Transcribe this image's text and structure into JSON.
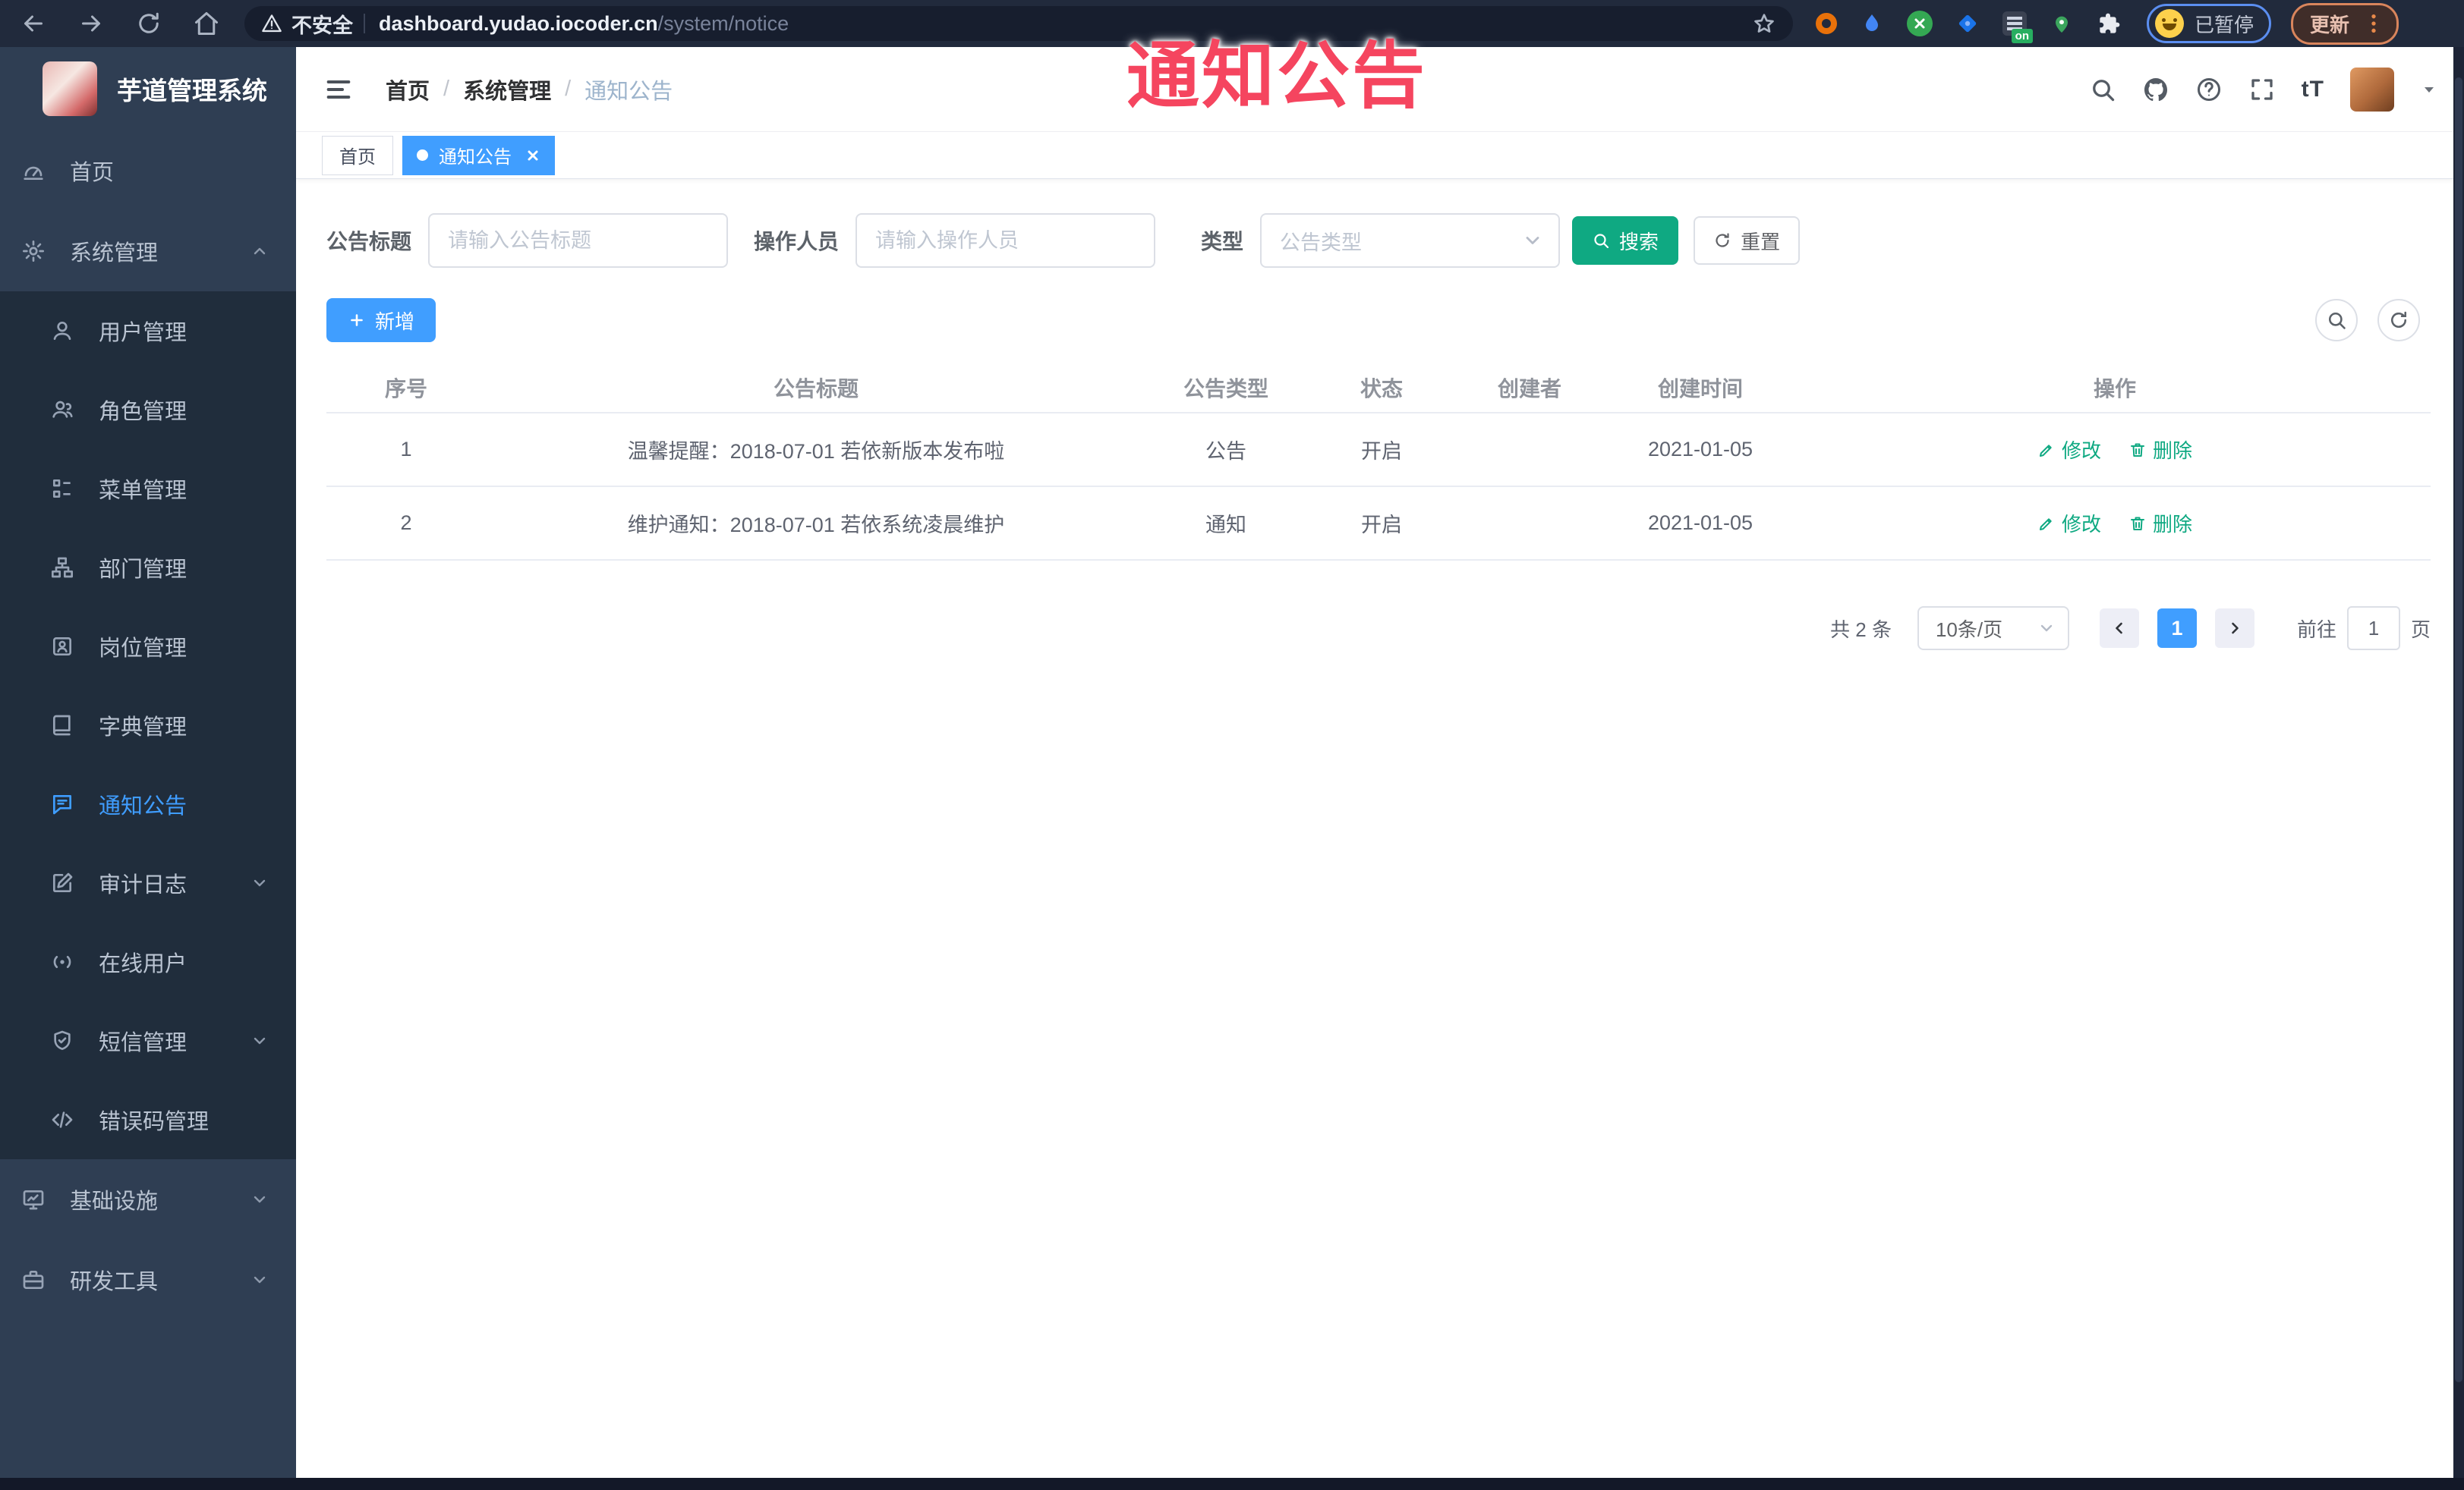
{
  "browser": {
    "security_label": "不安全",
    "url_domain": "dashboard.yudao.iocoder.cn",
    "url_path": "/system/notice",
    "extension_badge": "on",
    "profile_status": "已暂停",
    "update_label": "更新"
  },
  "watermark": "通知公告",
  "sidebar": {
    "title": "芋道管理系统",
    "items": [
      {
        "label": "首页"
      },
      {
        "label": "系统管理"
      },
      {
        "label": "用户管理"
      },
      {
        "label": "角色管理"
      },
      {
        "label": "菜单管理"
      },
      {
        "label": "部门管理"
      },
      {
        "label": "岗位管理"
      },
      {
        "label": "字典管理"
      },
      {
        "label": "通知公告"
      },
      {
        "label": "审计日志"
      },
      {
        "label": "在线用户"
      },
      {
        "label": "短信管理"
      },
      {
        "label": "错误码管理"
      },
      {
        "label": "基础设施"
      },
      {
        "label": "研发工具"
      }
    ]
  },
  "header": {
    "breadcrumb": {
      "home": "首页",
      "separator": "/",
      "section": "系统管理",
      "current": "通知公告"
    },
    "font_size_icon_label": "tT"
  },
  "tabs": {
    "home": "首页",
    "current": "通知公告"
  },
  "filters": {
    "title_label": "公告标题",
    "title_placeholder": "请输入公告标题",
    "operator_label": "操作人员",
    "operator_placeholder": "请输入操作人员",
    "type_label": "类型",
    "type_placeholder": "公告类型",
    "search_label": "搜索",
    "reset_label": "重置"
  },
  "toolbar": {
    "add_label": "新增"
  },
  "table": {
    "headers": {
      "index": "序号",
      "title": "公告标题",
      "type": "公告类型",
      "status": "状态",
      "creator": "创建者",
      "create_time": "创建时间",
      "actions": "操作"
    },
    "rows": [
      {
        "index": "1",
        "title": "温馨提醒：2018-07-01 若依新版本发布啦",
        "type": "公告",
        "status": "开启",
        "creator": "",
        "create_time": "2021-01-05"
      },
      {
        "index": "2",
        "title": "维护通知：2018-07-01 若依系统凌晨维护",
        "type": "通知",
        "status": "开启",
        "creator": "",
        "create_time": "2021-01-05"
      }
    ],
    "edit_label": "修改",
    "delete_label": "删除"
  },
  "pagination": {
    "total_label": "共 2 条",
    "page_size": "10条/页",
    "current_page": "1",
    "goto_label": "前往",
    "goto_value": "1",
    "page_unit_label": "页"
  },
  "colors": {
    "primary": "#409eff",
    "teal": "#0fa982",
    "watermark_pink": "#f5455f"
  }
}
